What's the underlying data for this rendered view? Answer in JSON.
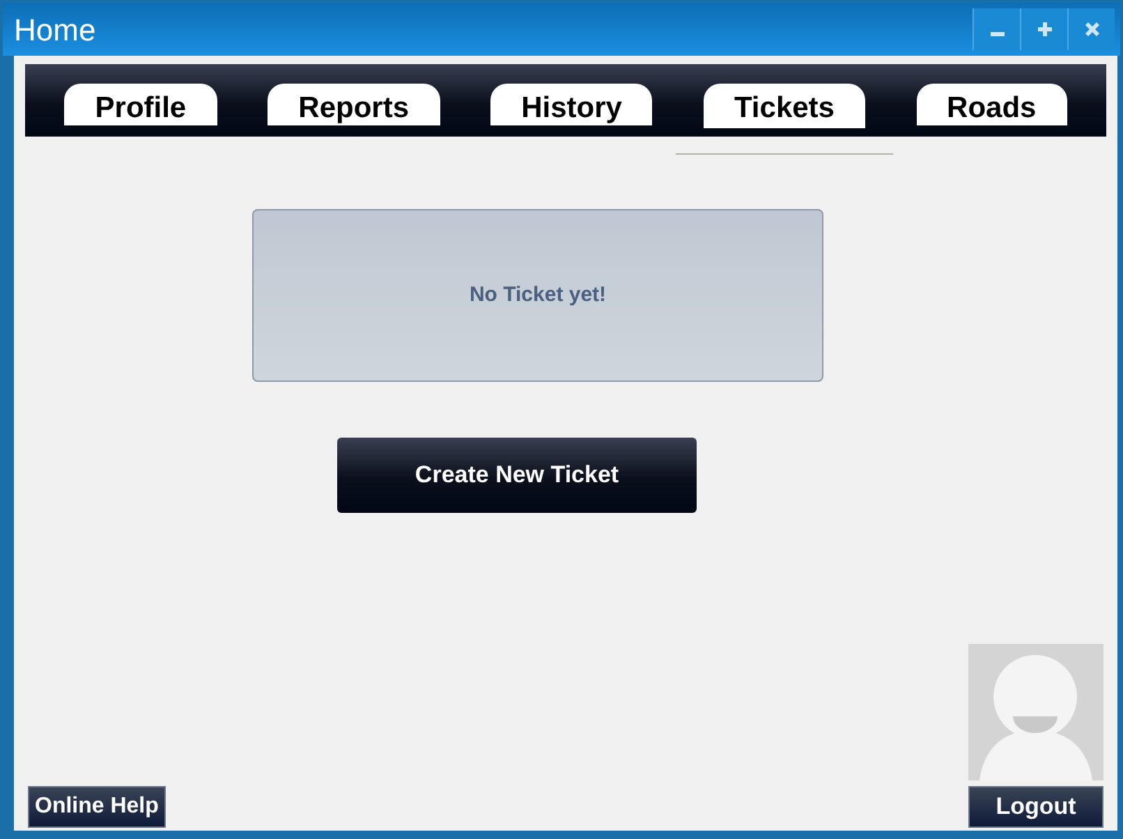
{
  "window": {
    "title": "Home"
  },
  "tabs": [
    {
      "label": "Profile",
      "selected": false
    },
    {
      "label": "Reports",
      "selected": false
    },
    {
      "label": "History",
      "selected": false
    },
    {
      "label": "Tickets",
      "selected": true
    },
    {
      "label": "Roads",
      "selected": false
    }
  ],
  "message": "No Ticket yet!",
  "create_button": "Create New Ticket",
  "help_button": "Online Help",
  "logout_button": "Logout"
}
